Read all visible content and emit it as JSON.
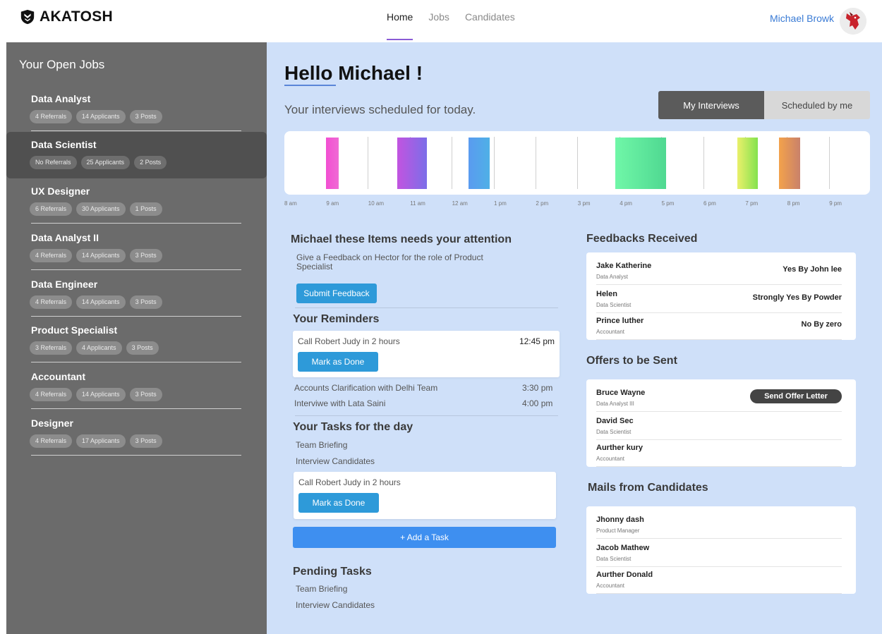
{
  "brand": {
    "name": "AKATOSH"
  },
  "nav": {
    "items": [
      {
        "label": "Home"
      },
      {
        "label": "Jobs"
      },
      {
        "label": "Candidates"
      }
    ]
  },
  "user": {
    "name": "Michael Browk"
  },
  "sidebar": {
    "title": "Your Open Jobs",
    "jobs": [
      {
        "title": "Data Analyst",
        "referrals": "4 Referrals",
        "applicants": "14 Applicants",
        "posts": "3 Posts"
      },
      {
        "title": "Data Scientist",
        "referrals": "No Referrals",
        "applicants": "25 Applicants",
        "posts": "2 Posts"
      },
      {
        "title": "UX Designer",
        "referrals": "6 Referrals",
        "applicants": "30 Applicants",
        "posts": "1 Posts"
      },
      {
        "title": "Data Analyst II",
        "referrals": "4 Referrals",
        "applicants": "14 Applicants",
        "posts": "3 Posts"
      },
      {
        "title": "Data Engineer",
        "referrals": "4 Referrals",
        "applicants": "14 Applicants",
        "posts": "3 Posts"
      },
      {
        "title": "Product Specialist",
        "referrals": "3 Referrals",
        "applicants": "4 Applicants",
        "posts": "3 Posts"
      },
      {
        "title": "Accountant",
        "referrals": "4 Referrals",
        "applicants": "14 Applicants",
        "posts": "3 Posts"
      },
      {
        "title": "Designer",
        "referrals": "4 Referrals",
        "applicants": "17 Applicants",
        "posts": "3 Posts"
      }
    ]
  },
  "main": {
    "greeting": "Hello Michael !",
    "subtitle": "Your interviews scheduled for today.",
    "toggle": {
      "mine": "My Interviews",
      "scheduled": "Scheduled by me"
    },
    "timeline": {
      "labels": [
        "8 am",
        "9 am",
        "10 am",
        "11 am",
        "12 am",
        "1 pm",
        "2 pm",
        "3 pm",
        "4 pm",
        "5 pm",
        "6 pm",
        "7 pm",
        "8 pm",
        "9 pm"
      ],
      "slots": [
        {
          "start": 9.0,
          "end": 9.3,
          "from": "#f24fd2",
          "to": "#f06ad4"
        },
        {
          "start": 10.7,
          "end": 11.4,
          "from": "#c254e0",
          "to": "#7b6ee8"
        },
        {
          "start": 12.4,
          "end": 12.9,
          "from": "#5a9bf0",
          "to": "#4fb0e6"
        },
        {
          "start": 15.9,
          "end": 17.1,
          "from": "#70f7a8",
          "to": "#4fd891"
        },
        {
          "start": 18.8,
          "end": 19.3,
          "from": "#eaf06b",
          "to": "#84e24e"
        },
        {
          "start": 19.8,
          "end": 20.3,
          "from": "#f3a24b",
          "to": "#c9816b"
        }
      ]
    },
    "attention": {
      "title": "Michael these Items needs your attention",
      "text": "Give a Feedback on Hector for the role of Product Specialist",
      "button": "Submit Feedback"
    },
    "reminders": {
      "title": "Your Reminders",
      "card": {
        "text": "Call Robert Judy in 2 hours",
        "time": "12:45 pm",
        "button": "Mark as Done"
      },
      "items": [
        {
          "text": "Accounts Clarification with Delhi Team",
          "time": "3:30 pm"
        },
        {
          "text": "Interviwe with Lata Saini",
          "time": "4:00 pm"
        }
      ]
    },
    "tasks": {
      "title": "Your Tasks for the day",
      "items": [
        "Team Briefing",
        "Interview Candidates"
      ],
      "card": {
        "text": "Call Robert Judy in 2 hours",
        "button": "Mark as Done"
      },
      "add_button": "+ Add a Task"
    },
    "pending": {
      "title": "Pending Tasks",
      "items": [
        "Team Briefing",
        "Interview Candidates"
      ]
    },
    "feedbacks": {
      "title": "Feedbacks Received",
      "rows": [
        {
          "name": "Jake Katherine",
          "role": "Data Analyst",
          "verdict": "Yes By John lee"
        },
        {
          "name": "Helen",
          "role": "Data Scientist",
          "verdict": "Strongly Yes By Powder"
        },
        {
          "name": "Prince luther",
          "role": "Accountant",
          "verdict": "No By zero"
        }
      ]
    },
    "offers": {
      "title": "Offers to be Sent",
      "button": "Send Offer Letter",
      "rows": [
        {
          "name": "Bruce Wayne",
          "role": "Data Analyst III"
        },
        {
          "name": "David Sec",
          "role": "Data Scientist"
        },
        {
          "name": "Aurther kury",
          "role": "Accountant"
        }
      ]
    },
    "mails": {
      "title": "Mails from Candidates",
      "rows": [
        {
          "name": "Jhonny dash",
          "role": "Product Manager"
        },
        {
          "name": "Jacob Mathew",
          "role": "Data Scientist"
        },
        {
          "name": "Aurther Donald",
          "role": "Accountant"
        }
      ]
    }
  }
}
